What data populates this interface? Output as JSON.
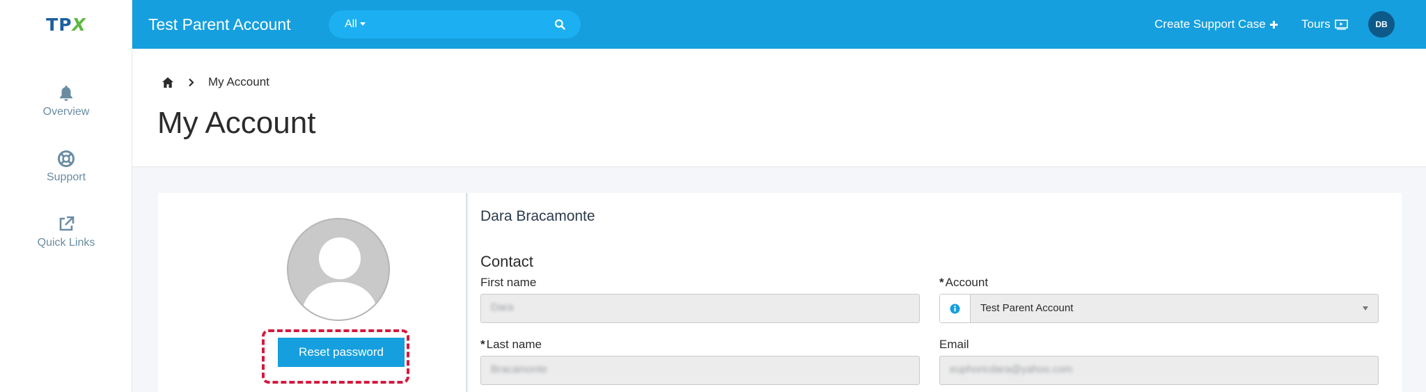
{
  "brand": {
    "logo_main": "TP",
    "logo_accent": "X"
  },
  "sidebar": {
    "items": [
      {
        "label": "Overview",
        "icon": "bell-icon"
      },
      {
        "label": "Support",
        "icon": "lifebuoy-icon"
      },
      {
        "label": "Quick Links",
        "icon": "external-link-icon"
      }
    ]
  },
  "header": {
    "account_title": "Test Parent Account",
    "search_scope": "All",
    "search_placeholder": "",
    "create_support_case": "Create Support Case",
    "tours": "Tours",
    "avatar_initials": "DB"
  },
  "breadcrumb": {
    "current": "My Account"
  },
  "page": {
    "title": "My Account"
  },
  "profile": {
    "reset_password_label": "Reset password"
  },
  "details": {
    "user_name": "Dara Bracamonte",
    "section_title": "Contact",
    "first_name_label": "First name",
    "first_name_value": "Dara",
    "last_name_label": "Last name",
    "last_name_value": "Bracamonte",
    "account_label": "Account",
    "account_value": "Test Parent Account",
    "email_label": "Email",
    "email_value": "euphoricdara@yahoo.com",
    "required_marker": "*"
  },
  "colors": {
    "header_bg": "#159fde",
    "accent": "#159fde",
    "highlight": "#d6193e",
    "sidebar_text": "#6a8ca3"
  }
}
